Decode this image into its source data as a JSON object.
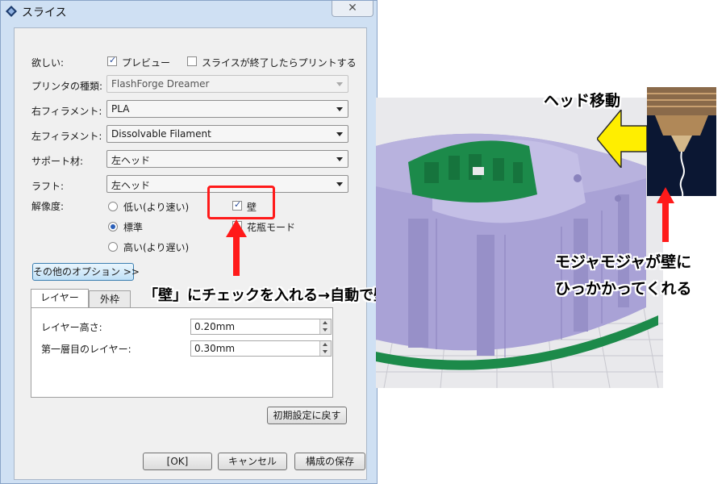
{
  "window": {
    "title": "スライス",
    "close_label": "✕"
  },
  "options": {
    "want_label": "欲しい:",
    "preview": {
      "label": "プレビュー",
      "checked": true
    },
    "print_after": {
      "label": "スライスが終了したらプリントする",
      "checked": false
    }
  },
  "fields": {
    "printer_type": {
      "label": "プリンタの種類:",
      "value": "FlashForge Dreamer",
      "disabled": true
    },
    "right_filament": {
      "label": "右フィラメント:",
      "value": "PLA"
    },
    "left_filament": {
      "label": "左フィラメント:",
      "value": "Dissolvable Filament"
    },
    "support": {
      "label": "サポート材:",
      "value": "左ヘッド"
    },
    "raft": {
      "label": "ラフト:",
      "value": "左ヘッド"
    }
  },
  "resolution": {
    "label": "解像度:",
    "options": [
      {
        "label": "低い(より速い)",
        "selected": false
      },
      {
        "label": "標準",
        "selected": true
      },
      {
        "label": "高い(より遅い)",
        "selected": false
      }
    ],
    "wall": {
      "label": "壁",
      "checked": true
    },
    "vase": {
      "label": "花瓶モード",
      "checked": false
    }
  },
  "more_options_label": "その他のオプション >>",
  "tabs": [
    {
      "label": "レイヤー",
      "active": true
    },
    {
      "label": "外枠",
      "active": false
    }
  ],
  "layer_settings": {
    "layer_height": {
      "label": "レイヤー高さ:",
      "value": "0.20mm"
    },
    "first_layer": {
      "label": "第一層目のレイヤー:",
      "value": "0.30mm"
    }
  },
  "buttons": {
    "reset": "初期設定に戻す",
    "ok": "[OK]",
    "cancel": "キャンセル",
    "save": "構成の保存"
  },
  "annotations": {
    "wall_note": "「壁」にチェックを入れる→自動で壁を追加",
    "head_move": "ヘッド移動",
    "fuzz_line1": "モジャモジャが壁に",
    "fuzz_line2": "ひっかかってくれる"
  },
  "colors": {
    "highlight": "#ff1a1a",
    "arrow_yellow": "#ffee00",
    "model_purple": "#a9a2d6",
    "model_green": "#1c8a4a"
  }
}
